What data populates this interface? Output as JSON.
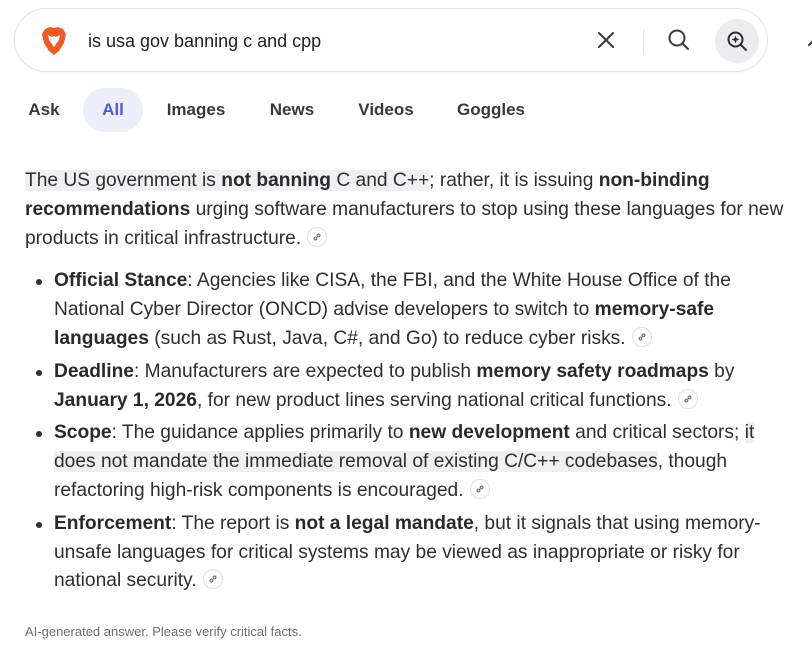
{
  "search": {
    "query": "is usa gov banning c and cpp"
  },
  "tabs": [
    {
      "label": "Ask",
      "active": false
    },
    {
      "label": "All",
      "active": true
    },
    {
      "label": "Images",
      "active": false
    },
    {
      "label": "News",
      "active": false
    },
    {
      "label": "Videos",
      "active": false
    },
    {
      "label": "Goggles",
      "active": false
    }
  ],
  "answer": {
    "intro": {
      "p1": "The US government is ",
      "b1": "not banning",
      "p2": " C and C++",
      "p3": "; rather, it is issuing ",
      "b2": "non-binding recommendations",
      "p4": " urging software manufacturers to stop using these languages for new products in critical infrastructure."
    },
    "bullets": {
      "official": {
        "title": "Official Stance",
        "t1": ": Agencies like CISA, the FBI, and the White House Office of the National Cyber Director (ONCD) advise developers to switch to ",
        "b1": "memory-safe languages",
        "t2": " (such as Rust, Java, C#, and Go) to reduce cyber risks."
      },
      "deadline": {
        "title": "Deadline",
        "t1": ": Manufacturers are expected to publish ",
        "b1": "memory safety roadmaps",
        "t2": " by ",
        "b2": "January 1, 2026",
        "t3": ", for new product lines serving national critical functions."
      },
      "scope": {
        "title": "Scope",
        "t1": ": The guidance applies primarily to ",
        "b1": "new development",
        "t2": " and critical sectors; ",
        "hl": "it does not mandate the immediate removal of existing C/C++ codebases",
        "t3": ", though refactoring high-risk components is encouraged."
      },
      "enforcement": {
        "title": "Enforcement",
        "t1": ": The report is ",
        "b1": "not a legal mandate",
        "t2": ", but it signals that using memory-unsafe languages for critical systems may be viewed as inappropriate or risky for national security."
      }
    }
  },
  "footer": {
    "note": "AI-generated answer. Please verify critical facts."
  },
  "icons": {
    "logo": "brave-lion-icon",
    "clear": "close-icon",
    "search": "search-icon",
    "ai": "ai-search-icon",
    "cite": "link-icon",
    "extra": "swap-icon"
  },
  "colors": {
    "accent": "#4a5bd8",
    "active_tab_bg": "#eceef9",
    "brave_orange": "#ef5a27"
  }
}
